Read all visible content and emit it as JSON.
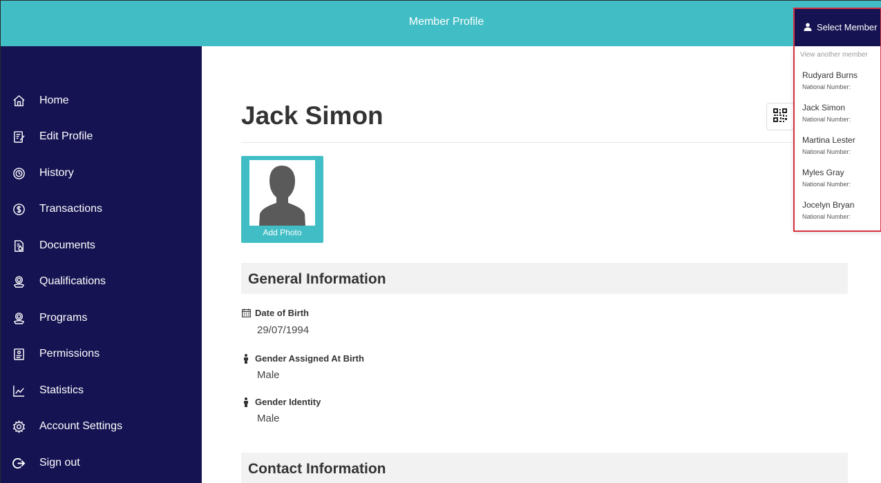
{
  "header": {
    "title": "Member Profile"
  },
  "sidebar": {
    "items": [
      {
        "label": "Home",
        "icon": "home-icon"
      },
      {
        "label": "Edit Profile",
        "icon": "edit-profile-icon"
      },
      {
        "label": "History",
        "icon": "history-icon"
      },
      {
        "label": "Transactions",
        "icon": "dollar-icon"
      },
      {
        "label": "Documents",
        "icon": "documents-icon"
      },
      {
        "label": "Qualifications",
        "icon": "qualifications-icon"
      },
      {
        "label": "Programs",
        "icon": "programs-icon"
      },
      {
        "label": "Permissions",
        "icon": "permissions-icon"
      },
      {
        "label": "Statistics",
        "icon": "statistics-icon"
      },
      {
        "label": "Account Settings",
        "icon": "gear-icon"
      },
      {
        "label": "Sign out",
        "icon": "sign-out-icon"
      }
    ]
  },
  "profile": {
    "name": "Jack Simon",
    "add_photo_label": "Add Photo"
  },
  "general": {
    "heading": "General Information",
    "dob_label": "Date of Birth",
    "dob_value": "29/07/1994",
    "gender_birth_label": "Gender Assigned At Birth",
    "gender_birth_value": "Male",
    "gender_identity_label": "Gender Identity",
    "gender_identity_value": "Male"
  },
  "contact": {
    "heading": "Contact Information"
  },
  "member_select": {
    "button_label": "Select Member",
    "heading": "View another member",
    "members": [
      {
        "name": "Rudyard Burns",
        "sub": "National Number:"
      },
      {
        "name": "Jack Simon",
        "sub": "National Number:"
      },
      {
        "name": "Martina Lester",
        "sub": "National Number:"
      },
      {
        "name": "Myles Gray",
        "sub": "National Number:"
      },
      {
        "name": "Jocelyn Bryan",
        "sub": "National Number:"
      }
    ]
  },
  "colors": {
    "topbar": "#41bec5",
    "sidebar": "#151352",
    "highlight": "#d9303f"
  }
}
